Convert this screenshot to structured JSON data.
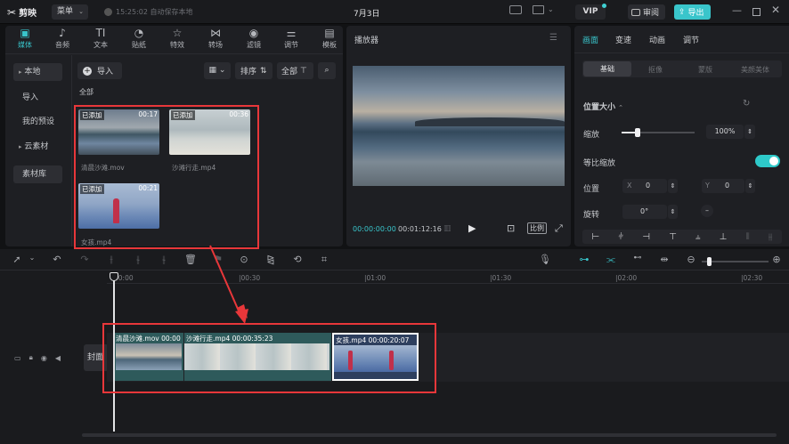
{
  "titlebar": {
    "app_name": "剪映",
    "menu_label": "菜单",
    "autosave": "15:25:02 自动保存本地",
    "project_title": "7月3日",
    "vip_label": "VIP",
    "review_label": "审阅",
    "export_label": "导出"
  },
  "media_tabs": [
    {
      "label": "媒体",
      "icon": "media-icon"
    },
    {
      "label": "音频",
      "icon": "audio-icon"
    },
    {
      "label": "文本",
      "icon": "text-icon"
    },
    {
      "label": "贴纸",
      "icon": "sticker-icon"
    },
    {
      "label": "特效",
      "icon": "effects-icon"
    },
    {
      "label": "转场",
      "icon": "transition-icon"
    },
    {
      "label": "滤镜",
      "icon": "filter-icon"
    },
    {
      "label": "调节",
      "icon": "adjust-icon"
    },
    {
      "label": "模板",
      "icon": "template-icon"
    }
  ],
  "sidebar": {
    "items": [
      {
        "label": "本地",
        "prefix": "▸"
      },
      {
        "label": "导入",
        "prefix": ""
      },
      {
        "label": "我的预设",
        "prefix": ""
      },
      {
        "label": "云素材",
        "prefix": "▸"
      },
      {
        "label": "素材库",
        "prefix": ""
      }
    ]
  },
  "media_toolbar": {
    "import_label": "导入",
    "sort_label": "排序",
    "all_label": "全部",
    "section_label": "全部"
  },
  "media_items": [
    {
      "tag": "已添加",
      "duration": "00:17",
      "name": "清晨沙滩.mov"
    },
    {
      "tag": "已添加",
      "duration": "00:36",
      "name": "沙滩行走.mp4"
    },
    {
      "tag": "已添加",
      "duration": "00:21",
      "name": "女孩.mp4"
    }
  ],
  "player": {
    "title": "播放器",
    "current_time": "00:00:00:00",
    "total_time": "00:01:12:16",
    "ratio_label": "比例"
  },
  "props": {
    "tabs": [
      "画面",
      "变速",
      "动画",
      "调节"
    ],
    "subtabs": [
      "基础",
      "抠像",
      "蒙版",
      "美颜美体"
    ],
    "section": "位置大小",
    "scale_label": "缩放",
    "scale_value": 1.0,
    "scale_text": "100%",
    "uniform_label": "等比缩放",
    "position_label": "位置",
    "x_label": "X",
    "x_value": "0",
    "y_label": "Y",
    "y_value": "0",
    "rotate_label": "旋转",
    "rotate_value": "0°"
  },
  "timeline": {
    "ticks": [
      "00:00",
      "|00:30",
      "|01:00",
      "|01:30",
      "|02:00",
      "|02:30"
    ],
    "cover_label": "封面",
    "clips": [
      {
        "name": "清晨沙滩.mov",
        "duration": "00:00"
      },
      {
        "name": "沙滩行走.mp4",
        "duration": "00:00:35:23"
      },
      {
        "name": "女孩.mp4",
        "duration": "00:00:20:07"
      }
    ]
  },
  "colors": {
    "accent": "#2ec9c9",
    "highlight": "#e8373a"
  }
}
